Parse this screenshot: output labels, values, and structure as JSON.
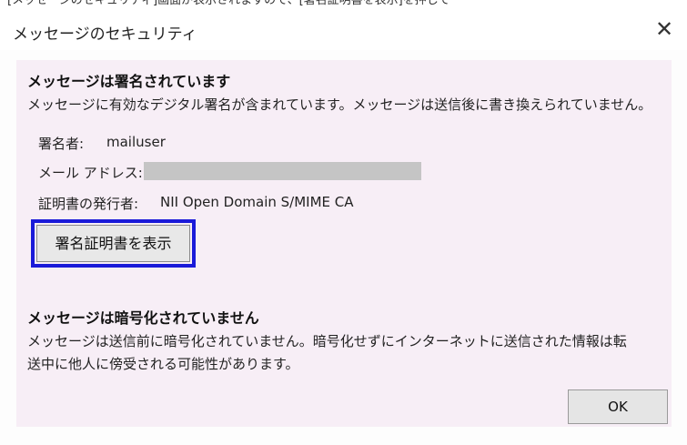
{
  "top_strip": "[メッセージのセキュリティ]画面が表示されますので、[署名証明書を表示]を押して",
  "dialog": {
    "title": "メッセージのセキュリティ",
    "close": "✕"
  },
  "signed": {
    "title": "メッセージは署名されています",
    "description": "メッセージに有効なデジタル署名が含まれています。メッセージは送信後に書き換えられていません。",
    "signer_label": "署名者:",
    "signer_value": "mailuser",
    "email_label": "メール アドレス:",
    "issuer_label": "証明書の発行者:",
    "issuer_value": "NII Open Domain S/MIME CA",
    "view_cert_button": "署名証明書を表示"
  },
  "encrypted": {
    "title": "メッセージは暗号化されていません",
    "description_line1": "メッセージは送信前に暗号化されていません。暗号化せずにインターネットに送信された情報は転",
    "description_line2": "送中に他人に傍受される可能性があります。"
  },
  "ok_button": "OK"
}
